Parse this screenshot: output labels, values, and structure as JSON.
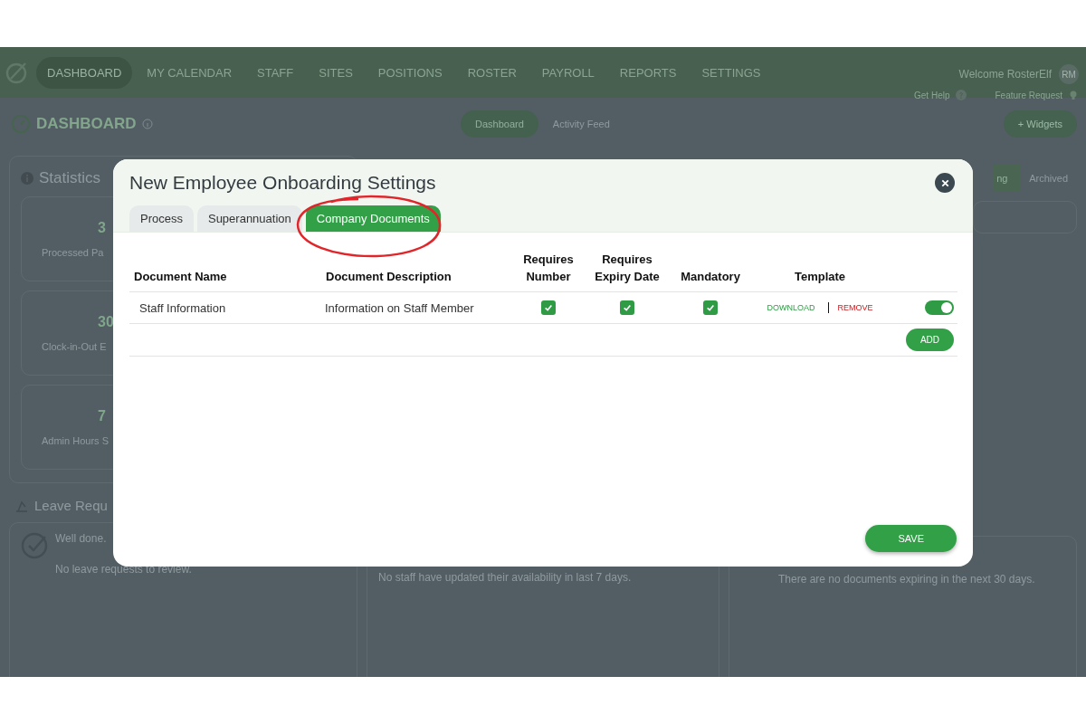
{
  "nav": {
    "items": [
      {
        "label": "DASHBOARD",
        "selected": true
      },
      {
        "label": "MY CALENDAR",
        "selected": false
      },
      {
        "label": "STAFF",
        "selected": false
      },
      {
        "label": "SITES",
        "selected": false
      },
      {
        "label": "POSITIONS",
        "selected": false
      },
      {
        "label": "ROSTER",
        "selected": false
      },
      {
        "label": "PAYROLL",
        "selected": false
      },
      {
        "label": "REPORTS",
        "selected": false
      },
      {
        "label": "SETTINGS",
        "selected": false
      }
    ],
    "welcome": "Welcome RosterElf",
    "avatar": "RM",
    "help": "Get Help",
    "feature_request": "Feature Request"
  },
  "page_header": {
    "title": "DASHBOARD",
    "tabs": [
      {
        "label": "Dashboard",
        "selected": true
      },
      {
        "label": "Activity Feed",
        "selected": false
      }
    ],
    "button": "+ Widgets"
  },
  "statistics": {
    "title": "Statistics",
    "items": [
      {
        "value": "3",
        "label": "Processed Pa"
      },
      {
        "value": "30",
        "label": "Clock-in-Out E"
      },
      {
        "value": "7",
        "label": "Admin Hours S"
      }
    ]
  },
  "leave_requests": {
    "title": "Leave Requ",
    "lines": [
      "Well done.",
      "No leave requests to review."
    ]
  },
  "availability": {
    "message": "No staff have updated their availability in last 7 days."
  },
  "documents": {
    "tabs": [
      {
        "label": "ng",
        "selected": true
      },
      {
        "label": "Archived",
        "selected": false
      }
    ],
    "message": "There are no documents expiring in the next 30 days."
  },
  "modal": {
    "title": "New Employee Onboarding Settings",
    "tabs": [
      {
        "label": "Process",
        "selected": false,
        "circled": false
      },
      {
        "label": "Superannuation",
        "selected": false,
        "circled": false
      },
      {
        "label": "Company Documents",
        "selected": true,
        "circled": true
      }
    ],
    "table": {
      "columns": [
        "Document Name",
        "Document Description",
        "Requires Number",
        "Requires Expiry Date",
        "Mandatory",
        "Template"
      ],
      "rows": [
        {
          "name": "Staff Information",
          "description": "Information on Staff Member",
          "requires_number": true,
          "requires_expiry_date": true,
          "mandatory": true,
          "actions": [
            "DOWNLOAD",
            "REMOVE"
          ],
          "on": true
        }
      ],
      "add_button": "ADD"
    },
    "save_button": "SAVE"
  }
}
